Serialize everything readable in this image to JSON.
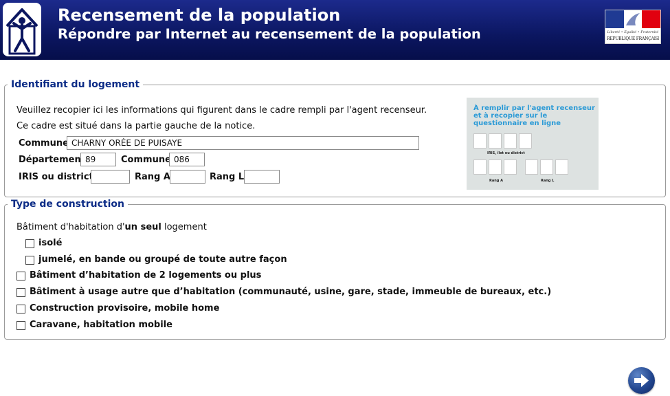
{
  "header": {
    "title": "Recensement de la population",
    "subtitle": "Répondre par Internet au recensement de la population",
    "gov_logo": {
      "motto": "Liberté • Égalité • Fraternité",
      "republic": "RÉPUBLIQUE FRANÇAISE"
    }
  },
  "identifiant": {
    "legend": "Identifiant du logement",
    "intro_line1": "Veuillez recopier ici les informations qui figurent dans le cadre rempli par l'agent recenseur.",
    "intro_line2": "Ce cadre est situé dans la partie gauche de la notice.",
    "commune_label": "Commune",
    "commune_value": "CHARNY ORÉE DE PUISAYE",
    "departement_label": "Département",
    "departement_value": "89",
    "commune_code_label": "Commune",
    "commune_code_value": "086",
    "iris_label": "IRIS ou district",
    "iris_value": "",
    "rang_a_label": "Rang A",
    "rang_a_value": "",
    "rang_l_label": "Rang L",
    "rang_l_value": "",
    "illustration": {
      "text": "À remplir par l'agent recenseur et à recopier sur le questionnaire en ligne",
      "iris_caption": "IRIS, îlot ou district",
      "rang_a_caption": "Rang A",
      "rang_l_caption": "Rang L"
    }
  },
  "construction": {
    "legend": "Type de construction",
    "question_prefix": "Bâtiment d'habitation d'",
    "question_bold": "un seul",
    "question_suffix": " logement",
    "options": [
      {
        "label": "isolé",
        "checked": false
      },
      {
        "label": "jumelé, en bande ou groupé de toute autre façon",
        "checked": false
      },
      {
        "label": "Bâtiment d’habitation de 2 logements ou plus",
        "checked": false
      },
      {
        "label": "Bâtiment à usage autre que d’habitation (communauté, usine, gare, stade, immeuble de bureaux, etc.)",
        "checked": false
      },
      {
        "label": "Construction provisoire, mobile home",
        "checked": false
      },
      {
        "label": "Caravane, habitation mobile",
        "checked": false
      }
    ]
  },
  "icons": {
    "logo": "census-house-person-icon",
    "next": "arrow-right-icon"
  },
  "colors": {
    "header_bg": "#0b1660",
    "legend_text": "#0b2b86",
    "illustration_text": "#2b9ad6",
    "illustration_bg": "#dde2e1",
    "next_button": "#22468f"
  }
}
